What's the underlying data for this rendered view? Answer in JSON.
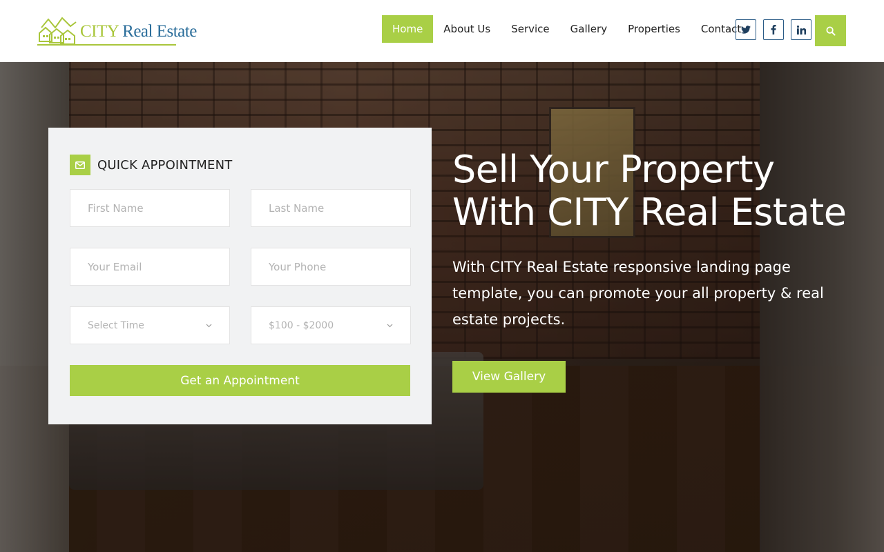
{
  "brand": {
    "city": "CITY",
    "real_estate": "Real Estate",
    "colors": {
      "accent": "#a9cf46",
      "logo_green": "#a9c63b",
      "logo_blue": "#2a6d9a",
      "social_border": "#2a5b86"
    }
  },
  "nav": {
    "items": [
      {
        "label": "Home",
        "active": true
      },
      {
        "label": "About Us"
      },
      {
        "label": "Service"
      },
      {
        "label": "Gallery"
      },
      {
        "label": "Properties"
      },
      {
        "label": "Contact"
      }
    ],
    "social": [
      "twitter-icon",
      "facebook-icon",
      "linkedin-icon"
    ],
    "search_icon": "search-icon"
  },
  "form": {
    "title": "QUICK APPOINTMENT",
    "icon": "mail-icon",
    "first_name_placeholder": "First Name",
    "last_name_placeholder": "Last Name",
    "email_placeholder": "Your Email",
    "phone_placeholder": "Your Phone",
    "time_select": "Select Time",
    "budget_select": "$100 - $2000",
    "submit_label": "Get an Appointment"
  },
  "hero": {
    "title_line1": "Sell Your Property",
    "title_line2": "With CITY Real Estate",
    "description": "With CITY Real Estate responsive landing page template, you can promote your all property & real estate projects.",
    "cta_label": "View Gallery"
  }
}
